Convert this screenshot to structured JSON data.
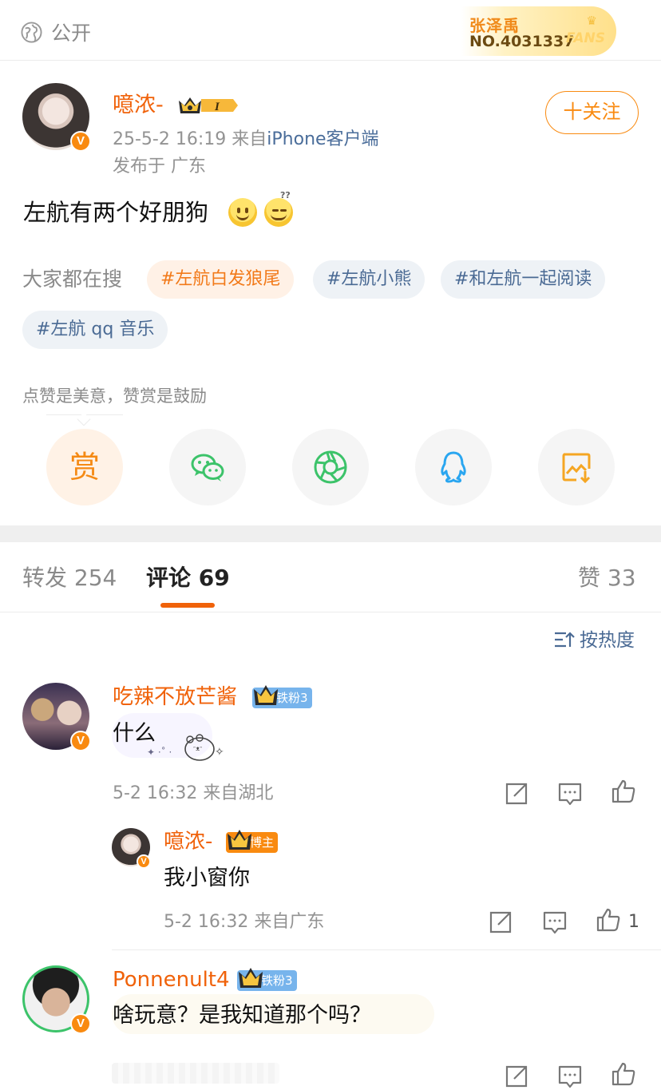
{
  "topbar": {
    "visibility_label": "公开",
    "fans_badge": {
      "name": "张泽禹",
      "number": "NO.4031337",
      "word": "FANS"
    }
  },
  "post": {
    "author": {
      "name": "噫浓-",
      "level": "I",
      "verified": "V"
    },
    "timestamp": "25-5-2 16:19",
    "source_prefix": "来自",
    "client": "iPhone客户端",
    "location": "发布于 广东",
    "follow_label": "十关注",
    "text": "左航有两个好朋狗",
    "emojis": [
      "smile-emoji",
      "thinking-grin-emoji"
    ]
  },
  "trending": {
    "label": "大家都在搜",
    "tags": [
      {
        "label": "#左航白发狼尾",
        "style": "hot"
      },
      {
        "label": "#左航小熊",
        "style": "normal"
      },
      {
        "label": "#和左航一起阅读",
        "style": "normal"
      },
      {
        "label": "#左航 qq 音乐",
        "style": "normal"
      }
    ]
  },
  "reward": {
    "text": "点赞是美意，赞赏是鼓励",
    "reward_glyph": "赏",
    "share_icons": [
      "reward-icon",
      "wechat-icon",
      "moments-icon",
      "qq-icon",
      "save-image-icon"
    ]
  },
  "tabs": {
    "repost": "转发 254",
    "comments": "评论 69",
    "likes": "赞 33"
  },
  "sort": {
    "label": "按热度"
  },
  "comments": [
    {
      "name": "吃辣不放芒酱",
      "badge": "铁粉3",
      "text": "什么",
      "meta": "5-2 16:32 来自湖北",
      "replies": [
        {
          "name": "噫浓-",
          "badge": "博主",
          "text": "我小窗你",
          "meta": "5-2 16:32 来自广东",
          "like_count": "1"
        }
      ]
    },
    {
      "name": "Ponnenult4",
      "badge": "铁粉3",
      "text": "啥玩意？是我知道那个吗？"
    }
  ],
  "colors": {
    "accent_orange": "#f0620a",
    "follow_orange": "#f98a10",
    "link_blue": "#4a6a94",
    "iron_fan_blue": "#77b4ec",
    "wechat_green": "#3cc36a",
    "qq_blue": "#2aa6f0",
    "save_orange": "#f5a623"
  }
}
